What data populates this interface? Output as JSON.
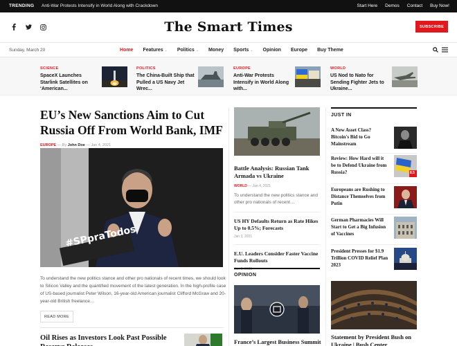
{
  "topbar": {
    "trending_label": "TRENDING",
    "trending_text": "Anti-War Protests Intensify in World Along with Crackdown",
    "links": [
      "Start Here",
      "Demos",
      "Contact",
      "Buy Now!"
    ]
  },
  "header": {
    "logo": "The Smart Times",
    "subscribe": "SUBSCRIBE",
    "social_icons": [
      "facebook-icon",
      "twitter-icon",
      "instagram-icon"
    ]
  },
  "nav": {
    "date": "Sunday, March 20",
    "items": [
      "Home",
      "Features",
      "Politics",
      "Money",
      "Sports",
      "Opinion",
      "Europe",
      "Buy Theme"
    ],
    "active": "Home"
  },
  "strip": [
    {
      "category": "SCIENCE",
      "title": "SpaceX Launches Starlink Satellites on ‘American..."
    },
    {
      "category": "POLITICS",
      "title": "The China-Built Ship that Pulled a US Navy Jet Wrec..."
    },
    {
      "category": "EUROPE",
      "title": "Anti-War Protests Intensify in World Along with..."
    },
    {
      "category": "WORLD",
      "title": "US Nod to Nato for Sending Fighter Jets to Ukraine..."
    }
  ],
  "main": {
    "headline": "EU’s New Sanctions Aim to Cut Russia Off From World Bank, IMF",
    "category": "EUROPE",
    "by": "By",
    "author": "John Doe",
    "date": "Jan 4, 2021",
    "hero_banner": "#SPpraTodos",
    "excerpt": "To understand the new politics stance and other pro nationals of recent times, we should look to Silicon Valley and the quantified movement of the latest generation. In the high-profile case of US-based journalist Peter Wilson, 16-year-old American journalist Clifford McGraw and 20-year-old British freelance…",
    "read_more": "READ MORE",
    "second_title": "Oil Rises as Investors Look Past Possible Reserve Releases"
  },
  "middle": {
    "feature_title": "Battle Analysis: Russian Tank Armada vs Ukraine",
    "feature_category": "WORLD",
    "feature_date": "Jan 4, 2021",
    "feature_excerpt": "To understand the new politics stance and other pro nationals of recent…",
    "items": [
      {
        "title": "US HY Defaults Return as Rate Hikes Up to 0.5%; Forecasts",
        "date": "Jan 3, 2021"
      },
      {
        "title": "E.U. Leaders Consider Faster Vaccine Funds Rollouts",
        "date": "Jan 3, 2021"
      }
    ],
    "opinion_label": "OPINION",
    "opinion_title": "France’s Largest Business Summit"
  },
  "right": {
    "label": "JUST IN",
    "items": [
      {
        "title": "A New Asset Class? Bitcoin's Bid to Go Mainstream"
      },
      {
        "title": "Review: How Hard will it be to Defend Ukraine from Russia?",
        "badge": "8.5"
      },
      {
        "title": "Europeans are Rushing to Distance Themselves from Putin"
      },
      {
        "title": "German Pharmacies Will Start to Get a Big Infusion of Vaccines"
      },
      {
        "title": "President Presses for $1.9 Trillion COVID Relief Plan 2023"
      }
    ],
    "bottom_title": "Statement by President Bush on Ukraine | Bush Center"
  },
  "colors": {
    "accent": "#e0181e",
    "topbar": "#111111"
  }
}
